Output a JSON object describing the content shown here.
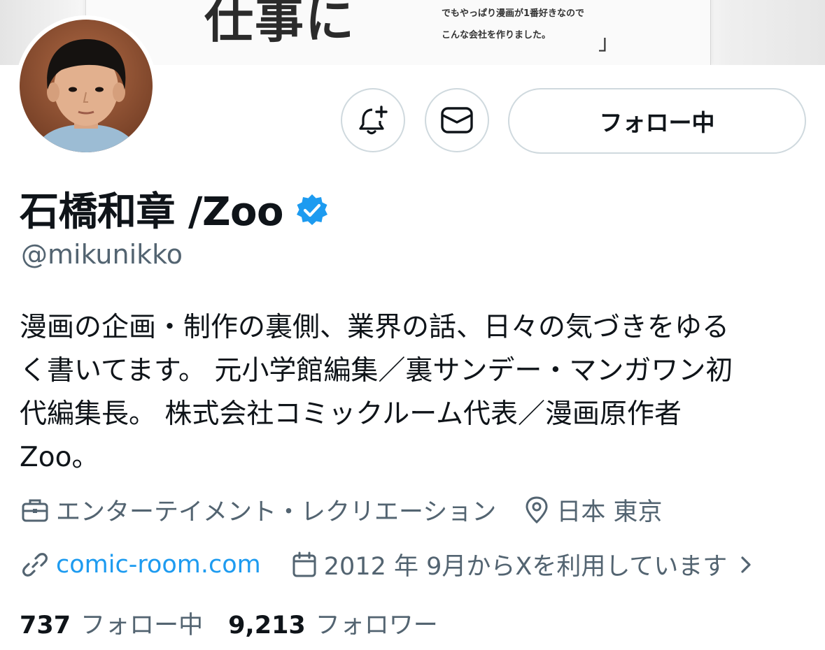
{
  "banner": {
    "big_text": "仕事に",
    "line1": "でもやっぱり漫画が1番好きなので",
    "line2": "こんな会社を作りました。",
    "bracket": "」"
  },
  "actions": {
    "notify_icon": "bell-plus-icon",
    "message_icon": "envelope-icon",
    "follow_label": "フォロー中"
  },
  "profile": {
    "display_name": "石橋和章 /Zoo",
    "verified": true,
    "verified_color": "#1d9bf0",
    "handle": "@mikunikko",
    "bio_lines": [
      "漫画の企画・制作の裏側、業界の話、日々の気づきをゆる",
      "く書いてます。 元小学館編集／裏サンデー・マンガワン初",
      "代編集長。 株式会社コミックルーム代表／漫画原作者",
      "Zoo。"
    ],
    "category": "エンターテイメント・レクリエーション",
    "location": "日本 東京",
    "website": "comic-room.com",
    "joined": "2012 年 9月からXを利用しています"
  },
  "stats": {
    "following_count": "737",
    "following_label": "フォロー中",
    "followers_count": "9,213",
    "followers_label": "フォロワー"
  },
  "colors": {
    "text": "#0f1419",
    "secondary": "#536471",
    "link": "#1d9bf0",
    "border": "#cfd9de"
  }
}
